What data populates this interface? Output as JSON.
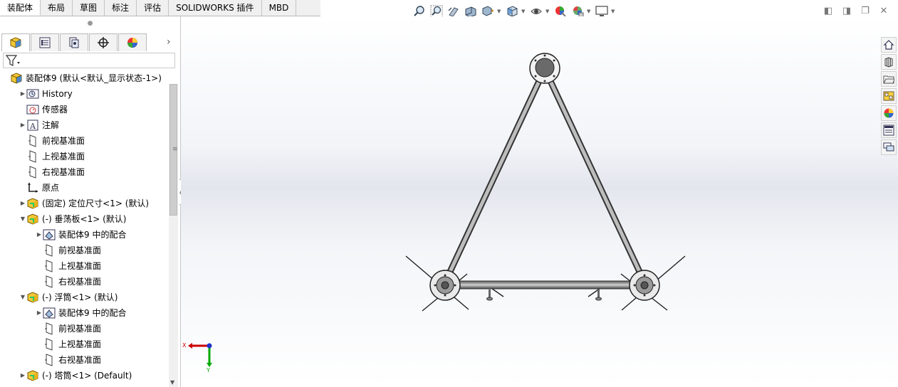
{
  "command_tabs": [
    "装配体",
    "布局",
    "草图",
    "标注",
    "评估",
    "SOLIDWORKS 插件",
    "MBD"
  ],
  "view_toolbar": [
    "zoom-to-fit-icon",
    "zoom-area-icon",
    "previous-view-icon",
    "section-view-icon",
    "dynamic-annotation-icon",
    "view-orientation-icon",
    "display-style-icon",
    "hide-show-icon",
    "edit-appearance-icon",
    "apply-scene-icon",
    "view-settings-icon"
  ],
  "panel_tabs": [
    "featuremanager-icon",
    "propertymanager-icon",
    "configurationmanager-icon",
    "dimxpert-icon",
    "displaymanager-icon"
  ],
  "tree": [
    {
      "label": "装配体9  (默认<默认_显示状态-1>)",
      "icon": "assembly-icon",
      "level": 0,
      "expander": ""
    },
    {
      "label": "History",
      "icon": "history-icon",
      "level": 1,
      "expander": "▶"
    },
    {
      "label": "传感器",
      "icon": "sensor-icon",
      "level": 1,
      "expander": ""
    },
    {
      "label": "注解",
      "icon": "annotation-icon",
      "level": 1,
      "expander": "▶"
    },
    {
      "label": "前视基准面",
      "icon": "plane-icon",
      "level": 1,
      "expander": ""
    },
    {
      "label": "上视基准面",
      "icon": "plane-icon",
      "level": 1,
      "expander": ""
    },
    {
      "label": "右视基准面",
      "icon": "plane-icon",
      "level": 1,
      "expander": ""
    },
    {
      "label": "原点",
      "icon": "origin-icon",
      "level": 1,
      "expander": ""
    },
    {
      "label": "(固定) 定位尺寸<1> (默认)",
      "icon": "part-icon",
      "level": 1,
      "expander": "▶"
    },
    {
      "label": "(-) 垂荡板<1> (默认)",
      "icon": "part-icon",
      "level": 1,
      "expander": "▼"
    },
    {
      "label": "装配体9 中的配合",
      "icon": "mates-icon",
      "level": 2,
      "expander": "▶"
    },
    {
      "label": "前视基准面",
      "icon": "plane-icon",
      "level": 2,
      "expander": ""
    },
    {
      "label": "上视基准面",
      "icon": "plane-icon",
      "level": 2,
      "expander": ""
    },
    {
      "label": "右视基准面",
      "icon": "plane-icon",
      "level": 2,
      "expander": ""
    },
    {
      "label": "(-) 浮筒<1> (默认)",
      "icon": "part-icon",
      "level": 1,
      "expander": "▼"
    },
    {
      "label": "装配体9 中的配合",
      "icon": "mates-icon",
      "level": 2,
      "expander": "▶"
    },
    {
      "label": "前视基准面",
      "icon": "plane-icon",
      "level": 2,
      "expander": ""
    },
    {
      "label": "上视基准面",
      "icon": "plane-icon",
      "level": 2,
      "expander": ""
    },
    {
      "label": "右视基准面",
      "icon": "plane-icon",
      "level": 2,
      "expander": ""
    },
    {
      "label": "(-) 塔筒<1> (Default)",
      "icon": "part-icon",
      "level": 1,
      "expander": "▶"
    }
  ],
  "task_pane": [
    "solidworks-resources-icon",
    "design-library-icon",
    "file-explorer-icon",
    "view-palette-icon",
    "appearances-icon",
    "custom-properties-icon",
    "forum-icon"
  ],
  "triad": {
    "x_label": "X",
    "y_label": "Y"
  }
}
